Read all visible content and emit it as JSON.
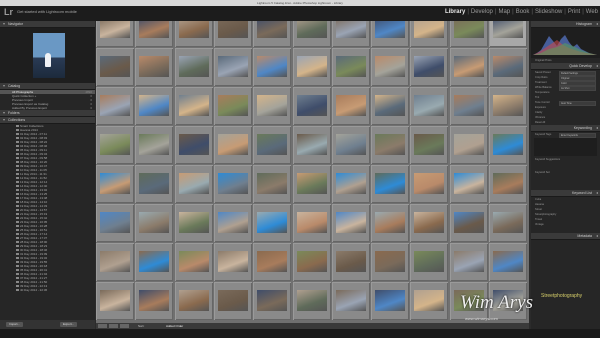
{
  "window": {
    "title": "Lightroom 5 Catalog.lrcat - Adobe Photoshop Lightroom - Library",
    "dot_colors": [
      "#fc605c",
      "#fdbc40",
      "#34c84a"
    ]
  },
  "topbar": {
    "logo": "Lr",
    "identity": "Get started with Lightroom mobile",
    "modules": [
      "Library",
      "Develop",
      "Map",
      "Book",
      "Slideshow",
      "Print",
      "Web"
    ],
    "active_module": "Library"
  },
  "left_panel": {
    "navigator_label": "Navigator",
    "catalog_label": "Catalog",
    "catalog_items": [
      {
        "label": "All Photographs",
        "count": "4890",
        "selected": true
      },
      {
        "label": "Quick Collection +",
        "count": "0"
      },
      {
        "label": "Previous Import",
        "count": "0"
      },
      {
        "label": "Previous Export as Catalog",
        "count": "0"
      },
      {
        "label": "Added By Previous Export",
        "count": "0"
      }
    ],
    "folders_label": "Folders",
    "collections_label": "Collections",
    "collections": [
      "Smart Collections",
      "Havana 2014",
      "01 Day 2014 - 07:11",
      "02 Day 2014 - 08:03",
      "03 Day 2014 - 08:22",
      "04 Day 2014 - 08:46",
      "05 Day 2014 - 09:11",
      "06 Day 2014 - 09:34",
      "07 Day 2014 - 09:58",
      "08 Day 2014 - 10:20",
      "09 Day 2014 - 10:47",
      "10 Day 2014 - 11:05",
      "11 Day 2014 - 11:31",
      "12 Day 2014 - 11:52",
      "13 Day 2014 - 12:14",
      "14 Day 2014 - 12:40",
      "15 Day 2014 - 13:02",
      "16 Day 2014 - 13:25",
      "17 Day 2014 - 13:48",
      "18 Day 2014 - 14:10",
      "19 Day 2014 - 14:33",
      "20 Day 2014 - 14:57",
      "21 Day 2014 - 15:19",
      "22 Day 2014 - 15:42",
      "23 Day 2014 - 16:05",
      "24 Day 2014 - 16:28",
      "25 Day 2014 - 16:51",
      "26 Day 2014 - 17:14",
      "27 Day 2014 - 17:37",
      "28 Day 2014 - 18:00",
      "29 Day 2014 - 18:23",
      "30 Day 2014 - 18:46",
      "31 Day 2014 - 19:09",
      "32 Day 2014 - 19:32",
      "33 Day 2014 - 19:55",
      "34 Day 2014 - 20:18",
      "35 Day 2014 - 20:41",
      "36 Day 2014 - 21:04",
      "37 Day 2014 - 21:27",
      "38 Day 2014 - 21:50",
      "39 Day 2014 - 22:13",
      "40 Day 2014 - 22:36"
    ],
    "import_button": "Import...",
    "export_button": "Export..."
  },
  "toolbar": {
    "sort_label": "Sort:",
    "sort_value": "Added Order"
  },
  "right_panel": {
    "histogram_label": "Histogram",
    "original_photo": "Original Photo",
    "quick_develop_label": "Quick Develop",
    "quick_develop_rows": [
      {
        "label": "Saved Preset",
        "value": "Default Settings"
      },
      {
        "label": "Crop Ratio",
        "value": "Original"
      },
      {
        "label": "Treatment",
        "value": "Color"
      },
      {
        "label": "White Balance",
        "value": "As Shot"
      },
      {
        "label": "Temperature",
        "value": ""
      },
      {
        "label": "Tint",
        "value": ""
      },
      {
        "label": "Tone Control",
        "value": "Auto Tone"
      },
      {
        "label": "Exposure",
        "value": ""
      },
      {
        "label": "Clarity",
        "value": ""
      },
      {
        "label": "Vibrance",
        "value": ""
      },
      {
        "label": "Reset All",
        "value": ""
      }
    ],
    "keywording_label": "Keywording",
    "keyword_tags_label": "Keyword Tags",
    "keyword_tags_value": "Enter Keywords",
    "keyword_suggestions": "Keyword Suggestions",
    "keyword_set": "Keyword Set",
    "keyword_list_label": "Keyword List",
    "keyword_list": [
      "Cuba",
      "Havana",
      "Street",
      "Streetphotography",
      "Travel",
      "Vintage"
    ],
    "metadata_label": "Metadata",
    "metadata_subtitle": "Streetphotography"
  },
  "watermark": {
    "name": "Wim Arys",
    "url": "www.wimarys.com"
  },
  "grid": {
    "selected_index": 10,
    "photo_tones": [
      "#7a6a5a",
      "#b98a6a",
      "#6f7f8f",
      "#a4a39a",
      "#5f6b5a",
      "#c9b49e",
      "#8b7b6a",
      "#3f4d6a",
      "#9aa4b4",
      "#a87c5c",
      "#6a7a5a",
      "#c79b74",
      "#4f87c6",
      "#8a6a4e",
      "#b0a090",
      "#5a6a7a",
      "#d4b48a",
      "#6a5a4a",
      "#2e8bd6",
      "#99aab0",
      "#7a8a5a"
    ]
  }
}
